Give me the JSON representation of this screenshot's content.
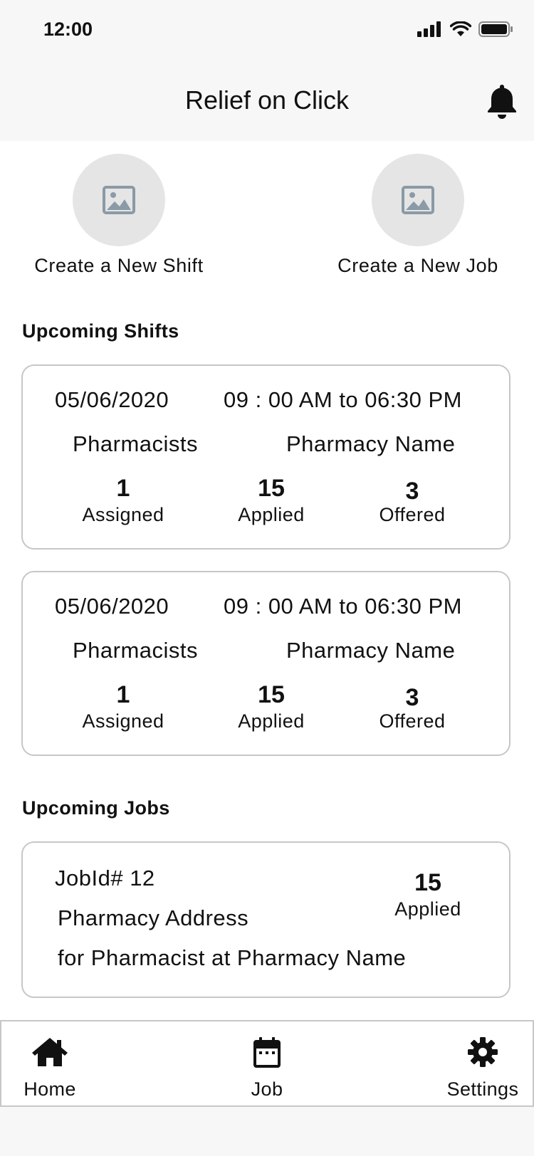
{
  "status_bar": {
    "time": "12:00"
  },
  "header": {
    "title": "Relief on Click",
    "icon": "bell-icon"
  },
  "quick_actions": [
    {
      "label": "Create a New Shift",
      "icon": "image-placeholder-icon"
    },
    {
      "label": "Create a New Job",
      "icon": "image-placeholder-icon"
    }
  ],
  "upcoming_shifts": {
    "title": "Upcoming Shifts",
    "items": [
      {
        "date": "05/06/2020",
        "time": "09 : 00 AM to 06:30 PM",
        "role": "Pharmacists",
        "pharmacy": "Pharmacy Name",
        "assigned": "1",
        "assigned_label": "Assigned",
        "applied": "15",
        "applied_label": "Applied",
        "offered": "3",
        "offered_label": "Offered"
      },
      {
        "date": "05/06/2020",
        "time": "09 : 00 AM to 06:30 PM",
        "role": "Pharmacists",
        "pharmacy": "Pharmacy Name",
        "assigned": "1",
        "assigned_label": "Assigned",
        "applied": "15",
        "applied_label": "Applied",
        "offered": "3",
        "offered_label": "Offered"
      }
    ]
  },
  "upcoming_jobs": {
    "title": "Upcoming Jobs",
    "items": [
      {
        "job_id": "JobId# 12",
        "address": "Pharmacy Address",
        "description": "for Pharmacist at Pharmacy Name",
        "applied": "15",
        "applied_label": "Applied"
      }
    ]
  },
  "tab_bar": [
    {
      "label": "Home",
      "icon": "home-icon"
    },
    {
      "label": "Job",
      "icon": "calendar-icon"
    },
    {
      "label": "Settings",
      "icon": "gear-icon"
    }
  ]
}
